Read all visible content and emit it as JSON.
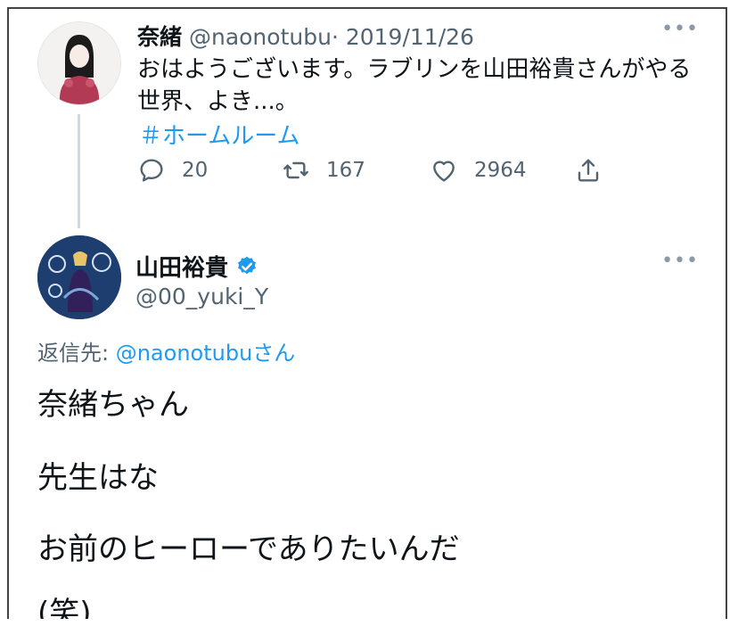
{
  "tweet1": {
    "name": "奈緒",
    "handle": "@naonotubu",
    "date_sep": "·",
    "date": "2019/11/26",
    "text_line1": "おはようございます。ラブリンを山田裕貴さんがやる",
    "text_line2": "世界、よき...。",
    "hashtag": "＃ホームルーム",
    "more": "•••",
    "actions": {
      "reply_count": "20",
      "retweet_count": "167",
      "like_count": "2964"
    }
  },
  "tweet2": {
    "name": "山田裕貴",
    "handle": "@00_yuki_Y",
    "more": "•••",
    "reply_to_prefix": "返信先: ",
    "reply_to_handle": "@naonotubu",
    "reply_to_suffix": "さん",
    "lines": [
      "奈緒ちゃん",
      "先生はな",
      "お前のヒーローでありたいんだ",
      "(笑)"
    ]
  },
  "colors": {
    "accent": "#1d9bf0",
    "text": "#0f1419",
    "muted": "#536471",
    "thread_line": "#cfd9de"
  },
  "icons": [
    "reply-icon",
    "retweet-icon",
    "like-icon",
    "share-icon",
    "verified-badge-icon",
    "more-icon"
  ]
}
